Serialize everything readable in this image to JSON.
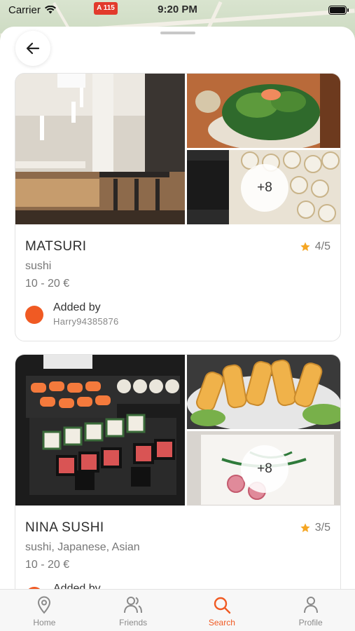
{
  "status_bar": {
    "carrier": "Carrier",
    "time": "9:20 PM",
    "road_sign": "A 115"
  },
  "restaurants": [
    {
      "name": "MATSURI",
      "cuisine": "sushi",
      "price": "10 - 20 €",
      "rating": "4/5",
      "more_photos": "+8",
      "added_by_label": "Added by",
      "added_by_user": "Harry94385876"
    },
    {
      "name": "NINA SUSHI",
      "cuisine": "sushi, Japanese, Asian",
      "price": "10 - 20 €",
      "rating": "3/5",
      "more_photos": "+8",
      "added_by_label": "Added by",
      "added_by_user": ""
    }
  ],
  "tabs": [
    {
      "label": "Home",
      "icon": "location-pin-icon"
    },
    {
      "label": "Friends",
      "icon": "friends-icon"
    },
    {
      "label": "Search",
      "icon": "search-icon",
      "active": true
    },
    {
      "label": "Profile",
      "icon": "profile-icon"
    }
  ],
  "colors": {
    "accent": "#f05a23",
    "star": "#f5a623"
  }
}
